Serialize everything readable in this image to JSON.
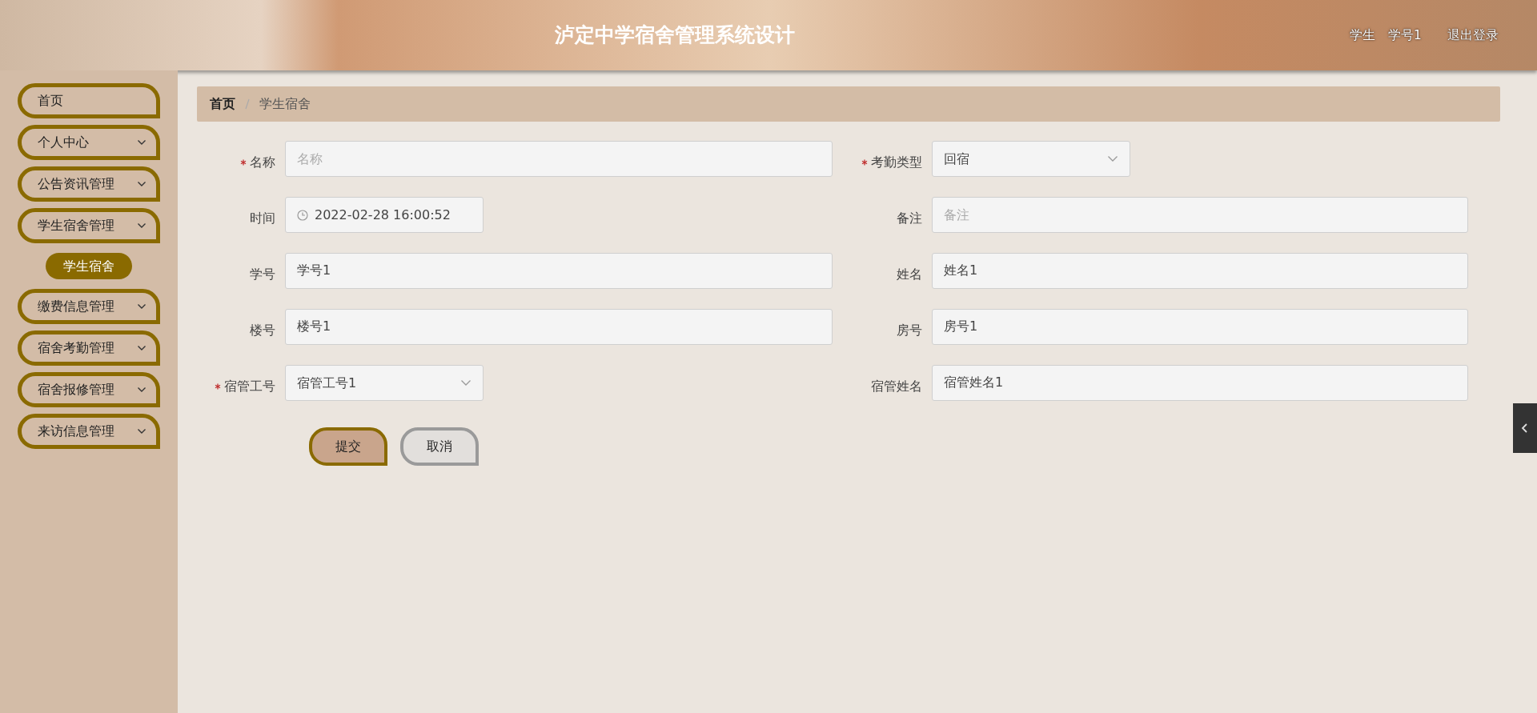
{
  "header": {
    "title": "泸定中学宿舍管理系统设计",
    "user_role": "学生",
    "user_name": "学号1",
    "logout": "退出登录"
  },
  "sidebar": {
    "items": [
      {
        "label": "首页",
        "selected": false,
        "has_submenu": false
      },
      {
        "label": "个人中心",
        "selected": false,
        "has_submenu": true
      },
      {
        "label": "公告资讯管理",
        "selected": false,
        "has_submenu": true
      },
      {
        "label": "学生宿舍管理",
        "selected": false,
        "has_submenu": true,
        "children": [
          {
            "label": "学生宿舍",
            "selected": true
          }
        ]
      },
      {
        "label": "缴费信息管理",
        "selected": false,
        "has_submenu": true
      },
      {
        "label": "宿舍考勤管理",
        "selected": false,
        "has_submenu": true
      },
      {
        "label": "宿舍报修管理",
        "selected": false,
        "has_submenu": true
      },
      {
        "label": "来访信息管理",
        "selected": false,
        "has_submenu": true
      }
    ]
  },
  "breadcrumb": [
    "首页",
    "学生宿舍"
  ],
  "form": {
    "fields": [
      {
        "label": "名称",
        "required": true,
        "kind": "input",
        "placeholder": "名称"
      },
      {
        "label": "考勤类型",
        "required": true,
        "kind": "select",
        "value": "回宿"
      },
      {
        "label": "时间",
        "required": false,
        "kind": "date",
        "value": "2022-02-28 16:00:52"
      },
      {
        "label": "备注",
        "required": false,
        "kind": "input",
        "placeholder": "备注"
      },
      {
        "label": "学号",
        "required": false,
        "kind": "input",
        "value": "学号1"
      },
      {
        "label": "姓名",
        "required": false,
        "kind": "input",
        "value": "姓名1"
      },
      {
        "label": "楼号",
        "required": false,
        "kind": "input",
        "value": "楼号1"
      },
      {
        "label": "房号",
        "required": false,
        "kind": "input",
        "value": "房号1"
      },
      {
        "label": "宿管工号",
        "required": true,
        "kind": "select",
        "value": "宿管工号1"
      },
      {
        "label": "宿管姓名",
        "required": false,
        "kind": "input",
        "value": "宿管姓名1"
      }
    ],
    "submit": "提交",
    "cancel": "取消"
  }
}
